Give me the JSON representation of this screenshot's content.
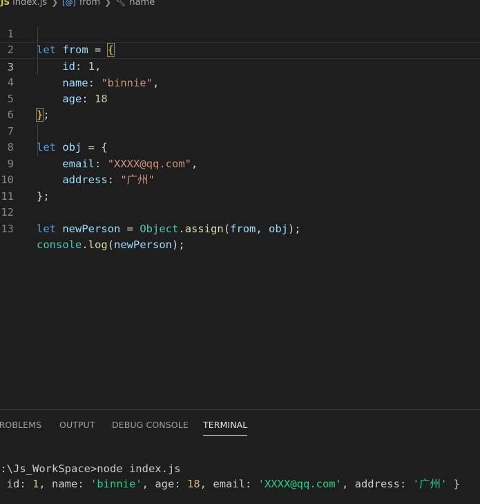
{
  "breadcrumb": {
    "js_badge": "JS",
    "file": "index.js",
    "var_icon": "[@]",
    "variable": "from",
    "key_icon": "wrench-key-icon",
    "property": "name"
  },
  "editor": {
    "line_numbers": [
      "1",
      "2",
      "3",
      "4",
      "5",
      "6",
      "7",
      "8",
      "9",
      "10",
      "11",
      "12",
      "13"
    ],
    "l1": {
      "kw": "let",
      "name": "from",
      "eq": " = ",
      "open": "{"
    },
    "l2": {
      "key": "id",
      "colon": ": ",
      "val": "1",
      "end": ","
    },
    "l3": {
      "key": "name",
      "colon": ": ",
      "val": "\"binnie\"",
      "end": ","
    },
    "l4": {
      "key": "age",
      "colon": ": ",
      "val": "18"
    },
    "l5": {
      "close": "}",
      "end": ";"
    },
    "l7": {
      "kw": "let",
      "name": "obj",
      "eq": " = ",
      "open": "{"
    },
    "l8": {
      "key": "email",
      "colon": ": ",
      "val": "\"XXXX@qq.com\"",
      "end": ","
    },
    "l9": {
      "key": "address",
      "colon": ": ",
      "val": "\"广州\""
    },
    "l10": {
      "close": "};"
    },
    "l12": {
      "kw": "let",
      "name": "newPerson",
      "eq": " = ",
      "cls": "Object",
      "dot": ".",
      "fn": "assign",
      "open": "(",
      "arg1": "from",
      "comma": ", ",
      "arg2": "obj",
      "close": ");"
    },
    "l13": {
      "obj": "console",
      "dot": ".",
      "fn": "log",
      "open": "(",
      "arg": "newPerson",
      "close": ");"
    }
  },
  "panel": {
    "tabs": [
      "PROBLEMS",
      "OUTPUT",
      "DEBUG CONSOLE",
      "TERMINAL"
    ],
    "active_tab": "TERMINAL",
    "terminal": {
      "prompt": "D:\\Js_WorkSpace>node index.js",
      "out": {
        "p1": "{ id: ",
        "id": "1",
        "p2": ", name: ",
        "name": "'binnie'",
        "p3": ", age: ",
        "age": "18",
        "p4": ", email: ",
        "email": "'XXXX@qq.com'",
        "p5": ", address: ",
        "address": "'广州'",
        "p6": " }"
      }
    }
  },
  "colors": {
    "background": "#1e1e1e",
    "keyword": "#569cd6",
    "variable": "#9cdcfe",
    "string": "#ce9178",
    "number": "#b5cea8",
    "class": "#4ec9b0",
    "function": "#dcdcaa",
    "bracket": "#ffd700",
    "terminal_string": "#23d18b",
    "terminal_number": "#d7ba7d"
  }
}
